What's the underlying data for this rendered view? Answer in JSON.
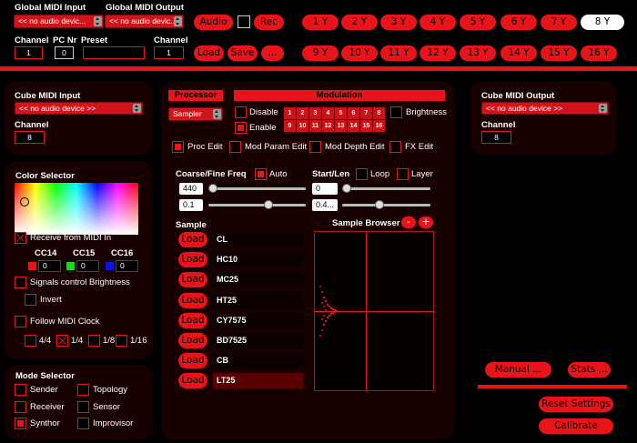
{
  "top": {
    "global_midi_input_label": "Global MIDI Input",
    "global_midi_input_value": "<< no audio devic...",
    "global_midi_output_label": "Global MIDI Output",
    "global_midi_output_value": "<< no audio devic...",
    "channel_label": "Channel",
    "channel_value": "1",
    "pc_nr_label": "PC Nr",
    "pc_nr_value": "0",
    "preset_label": "Preset",
    "preset_value": "",
    "channel2_label": "Channel",
    "channel2_value": "1",
    "audio": "Audio",
    "rec": "Rec",
    "load": "Load",
    "save": "Save",
    "more": "...",
    "voices": [
      "1 Y",
      "2 Y",
      "3 Y",
      "4 Y",
      "5 Y",
      "6 Y",
      "7 Y",
      "8 Y",
      "9 Y",
      "10 Y",
      "11 Y",
      "12 Y",
      "13 Y",
      "14 Y",
      "15 Y",
      "16 Y"
    ]
  },
  "cube_in": {
    "title": "Cube MIDI Input",
    "device": "<< no audio device >>",
    "channel_label": "Channel",
    "channel": "8"
  },
  "color": {
    "title": "Color Selector",
    "receive": "Receive from MIDI In",
    "cc14": "CC14",
    "cc15": "CC15",
    "cc16": "CC16",
    "v14": "0",
    "v15": "0",
    "v16": "0",
    "signals": "Signals control Brightness",
    "invert": "Invert",
    "follow": "Follow MIDI Clock",
    "divs": [
      "4/4",
      "1/4",
      "1/8",
      "1/16"
    ]
  },
  "mode": {
    "title": "Mode Selector",
    "sender": "Sender",
    "topology": "Topology",
    "receiver": "Receiver",
    "sensor": "Sensor",
    "synthor": "Synthor",
    "improvisor": "Improvisor"
  },
  "center": {
    "processor": "Processor",
    "processor_value": "Sampler",
    "modulation": "Modulation",
    "disable": "Disable",
    "enable": "Enable",
    "brightness": "Brightness",
    "mod_nums": [
      "1",
      "2",
      "3",
      "4",
      "5",
      "6",
      "7",
      "8",
      "9",
      "10",
      "11",
      "12",
      "13",
      "14",
      "15",
      "16"
    ],
    "proc_edit": "Proc Edit",
    "mod_param_edit": "Mod Param Edit",
    "mod_depth_edit": "Mod Depth Edit",
    "fx_edit": "FX Edit",
    "coarse": "Coarse/Fine Freq",
    "auto": "Auto",
    "startlen": "Start/Len",
    "loop": "Loop",
    "layer": "Layer",
    "coarse_val": "440",
    "fine_val": "0.1",
    "start_val": "0",
    "len_val": "0.4...",
    "sample": "Sample",
    "sample_browser": "Sample Browser",
    "minus": "-",
    "plus": "+",
    "load_label": "Load",
    "samples": [
      "CL",
      "HC10",
      "MC25",
      "HT25",
      "CY7575",
      "BD7525",
      "CB",
      "LT25"
    ]
  },
  "cube_out": {
    "title": "Cube MIDI Output",
    "device": "<< no audio device >>",
    "channel_label": "Channel",
    "channel": "8"
  },
  "bottom_right": {
    "manual": "Manual ...",
    "stats": "Stats ...",
    "reset": "Reset Settings",
    "calibrate": "Calibrate"
  },
  "colors": {
    "accent": "#e8141a",
    "panel": "#190000",
    "background": "#000000"
  }
}
